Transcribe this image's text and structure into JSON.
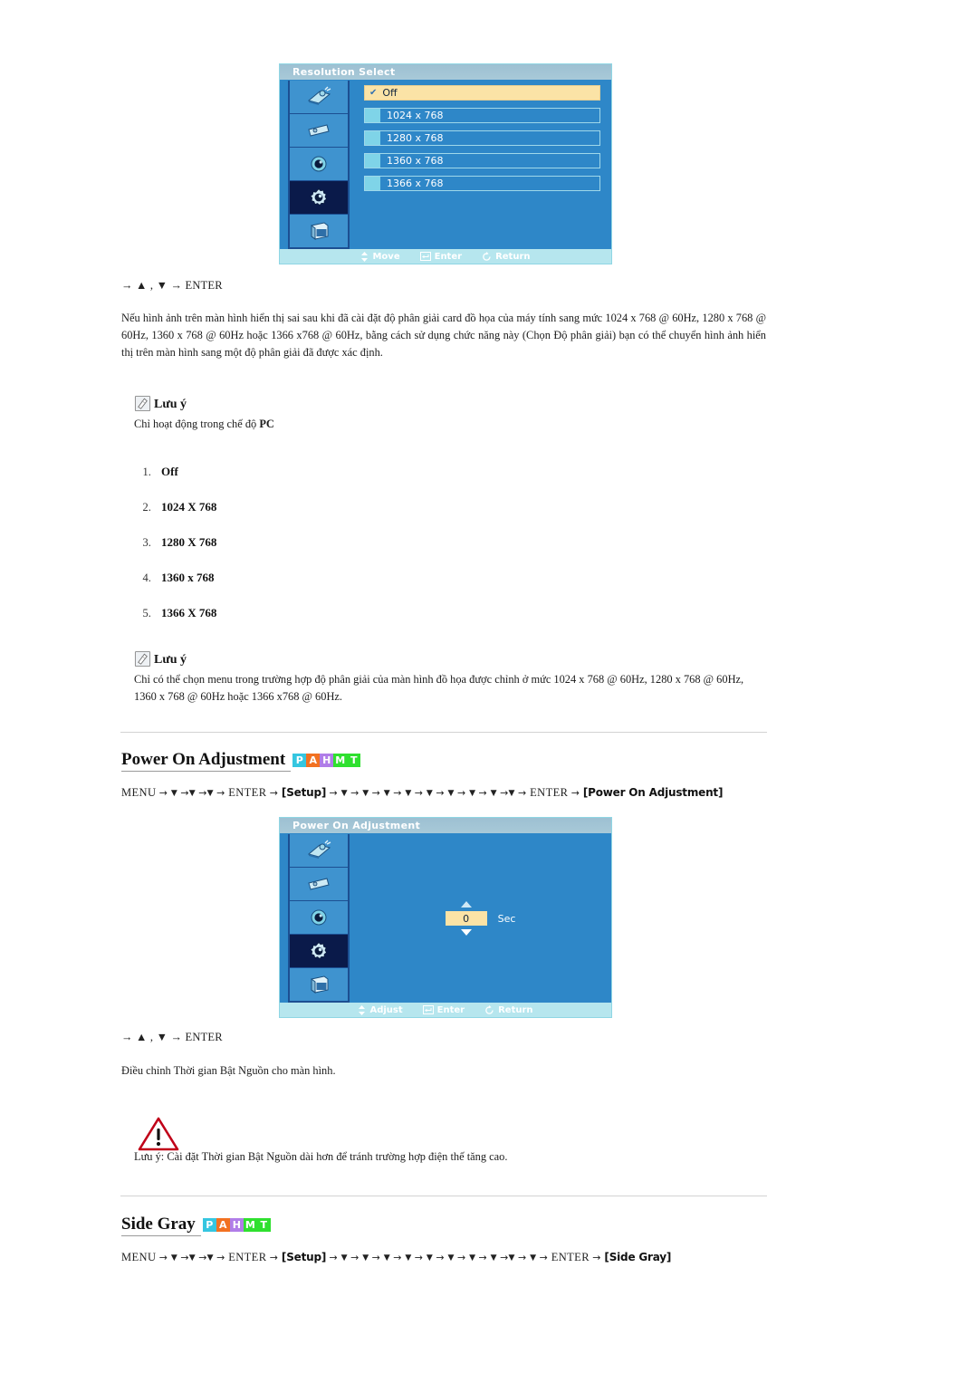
{
  "osd_resolution": {
    "title": "Resolution Select",
    "options": [
      {
        "label": "Off",
        "selected": true
      },
      {
        "label": "1024 x 768",
        "selected": false
      },
      {
        "label": "1280 x 768",
        "selected": false
      },
      {
        "label": "1360 x 768",
        "selected": false
      },
      {
        "label": "1366 x 768",
        "selected": false
      }
    ],
    "footer": [
      {
        "icon": "updown-arrows-icon",
        "label": "Move"
      },
      {
        "icon": "enter-key-icon",
        "label": "Enter"
      },
      {
        "icon": "return-arrow-icon",
        "label": "Return"
      }
    ],
    "rail_icons": [
      "picture-icon",
      "sound-icon",
      "setup-display-icon",
      "gear-setup-icon",
      "multi-control-icon"
    ]
  },
  "osd_power_on": {
    "title": "Power On Adjustment",
    "value": "0",
    "unit": "Sec",
    "footer": [
      {
        "icon": "updown-arrows-icon",
        "label": "Adjust"
      },
      {
        "icon": "enter-key-icon",
        "label": "Enter"
      },
      {
        "icon": "return-arrow-icon",
        "label": "Return"
      }
    ],
    "rail_icons": [
      "picture-icon",
      "sound-icon",
      "setup-display-icon",
      "gear-setup-icon",
      "multi-control-icon"
    ]
  },
  "nav_enter_1": "→ ▲ , ▼ → ENTER",
  "nav_enter_2": "→ ▲ , ▼ → ENTER",
  "paragraph_1": "Nếu hình ảnh trên màn hình hiển thị sai sau khi đã cài đặt độ phân giải card đồ họa của máy tính sang mức 1024 x 768 @ 60Hz, 1280 x 768 @ 60Hz, 1360 x 768 @ 60Hz hoặc 1366 x768 @ 60Hz, bằng cách sử dụng chức năng này (Chọn Độ phân giải) bạn có thể chuyển hình ảnh hiển thị trên màn hình sang một độ phân giải đã được xác định.",
  "note_1": {
    "icon": "note-pencil-icon",
    "title": "Lưu ý",
    "text_prefix": "Chỉ hoạt động trong chế độ ",
    "text_bold": "PC"
  },
  "resolution_list": [
    "Off",
    "1024 X 768",
    "1280 X 768",
    "1360 x 768",
    "1366 X 768"
  ],
  "note_2": {
    "icon": "note-pencil-icon",
    "title": "Lưu ý",
    "text": "Chỉ có thể chọn menu trong trường hợp độ phân giải của màn hình đồ họa được chỉnh ở mức 1024 x 768 @ 60Hz, 1280 x 768 @ 60Hz, 1360 x 768 @ 60Hz hoặc 1366 x768 @ 60Hz."
  },
  "section_power_on": {
    "title": "Power On Adjustment",
    "badges": [
      {
        "letter": "P",
        "color": "#35c6e0"
      },
      {
        "letter": "A",
        "color": "#f27121"
      },
      {
        "letter": "H",
        "color": "#b07de8"
      },
      {
        "letter": "M",
        "color": "#2fe02f"
      },
      {
        "letter": "T",
        "color": "#2fe02f"
      }
    ],
    "nav_prefix": "MENU",
    "nav_tag_1": "[Setup]",
    "nav_enter": "ENTER",
    "nav_tag_2": "[Power On Adjustment]",
    "arrows_before_enter": 3,
    "arrows_after_setup": 9
  },
  "power_on_description": "Điều chỉnh Thời gian Bật Nguồn cho màn hình.",
  "warning": {
    "icon": "warning-triangle-icon",
    "text": "Lưu ý: Cài đặt Thời gian Bật Nguồn dài hơn để tránh trường hợp điện thế tăng cao."
  },
  "section_side_gray": {
    "title": "Side Gray",
    "badges": [
      {
        "letter": "P",
        "color": "#35c6e0"
      },
      {
        "letter": "A",
        "color": "#f27121"
      },
      {
        "letter": "H",
        "color": "#b07de8"
      },
      {
        "letter": "M",
        "color": "#2fe02f"
      },
      {
        "letter": "T",
        "color": "#2fe02f"
      }
    ],
    "nav_prefix": "MENU",
    "nav_tag_1": "[Setup]",
    "nav_enter": "ENTER",
    "nav_tag_2": "[Side Gray]",
    "arrows_before_enter": 3,
    "arrows_after_setup": 10
  }
}
